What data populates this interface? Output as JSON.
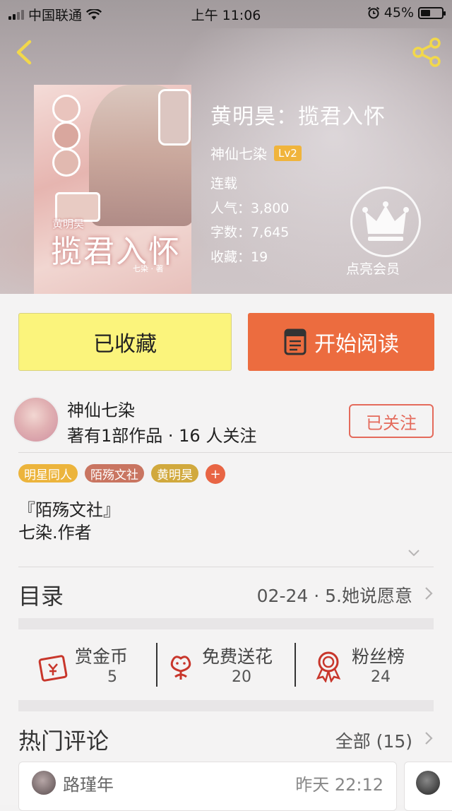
{
  "status_bar": {
    "carrier": "中国联通",
    "time": "上午 11:06",
    "battery": "45%",
    "battery_level": 0.45
  },
  "book": {
    "title": "黄明昊：揽君入怀",
    "author": "神仙七染",
    "author_level": "Lv2",
    "status": "连载",
    "popularity": "人气：3,800",
    "word_count": "字数：7,645",
    "favorites": "收藏：19",
    "cover": {
      "title_art": "揽君入怀",
      "subtitle_art": "黄明昊",
      "author_art": "七染 · 著"
    }
  },
  "vip": {
    "label": "点亮会员"
  },
  "buttons": {
    "favorited": "已收藏",
    "start_reading": "开始阅读"
  },
  "author_card": {
    "name": "神仙七染",
    "subtitle": "著有1部作品 · 16 人关注",
    "follow": "已关注"
  },
  "tags": [
    {
      "label": "明星同人",
      "color": "#ecb43c"
    },
    {
      "label": "陌殇文社",
      "color": "#c97561"
    },
    {
      "label": "黄明昊",
      "color": "#d1a93d"
    }
  ],
  "tag_more": "+",
  "description": {
    "line1": "『陌殇文社』",
    "line2": "七染.作者"
  },
  "toc": {
    "label": "目录",
    "latest": "02-24 · 5.她说愿意"
  },
  "actions": [
    {
      "label": "赏金币",
      "value": "5",
      "icon": "red-envelope-icon"
    },
    {
      "label": "免费送花",
      "value": "20",
      "icon": "flower-icon"
    },
    {
      "label": "粉丝榜",
      "value": "24",
      "icon": "medal-icon"
    }
  ],
  "hot_comments": {
    "label": "热门评论",
    "all": "全部 (15)",
    "first": {
      "user": "路瑾年",
      "time": "昨天 22:12"
    }
  },
  "colors": {
    "favorite_btn": "#fbf47c",
    "read_btn": "#ec6c3f",
    "accent_red": "#e46a5b"
  }
}
